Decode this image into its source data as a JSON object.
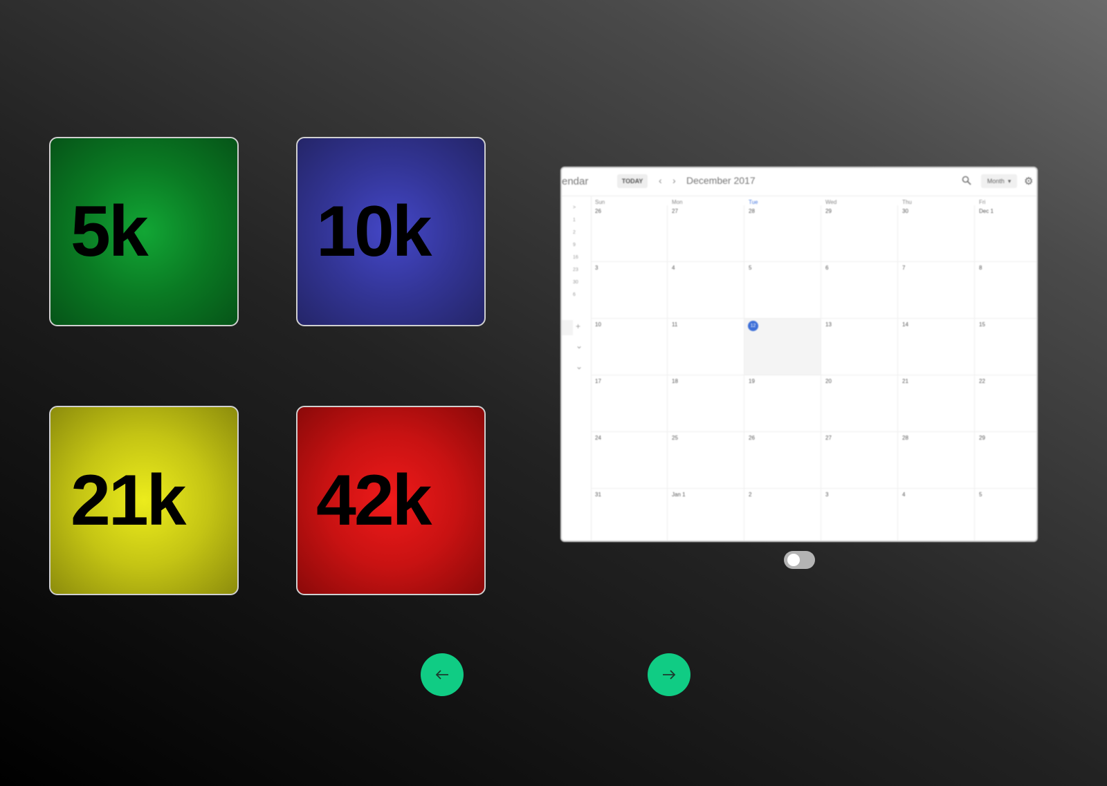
{
  "tiles": [
    {
      "id": "green",
      "label": "5k",
      "color": "#0a7a23"
    },
    {
      "id": "blue",
      "label": "10k",
      "color": "#333596"
    },
    {
      "id": "yellow",
      "label": "21k",
      "color": "#c4c414"
    },
    {
      "id": "red",
      "label": "42k",
      "color": "#c81212"
    }
  ],
  "calendar": {
    "app_name": "endar",
    "today_label": "TODAY",
    "prev_icon": "chevron-left-icon",
    "next_icon": "chevron-right-icon",
    "month_title": "December 2017",
    "view_select": "Month",
    "search_icon": "search-icon",
    "settings_icon": "gear-icon",
    "weekdays": [
      "Sun",
      "Mon",
      "Tue",
      "Wed",
      "Thu",
      "Fri"
    ],
    "highlight_weekday": "Tue",
    "weeks": [
      [
        "26",
        "27",
        "28",
        "29",
        "30",
        "Dec 1"
      ],
      [
        "3",
        "4",
        "5",
        "6",
        "7",
        "8"
      ],
      [
        "10",
        "11",
        "12",
        "13",
        "14",
        "15"
      ],
      [
        "17",
        "18",
        "19",
        "20",
        "21",
        "22"
      ],
      [
        "24",
        "25",
        "26",
        "27",
        "28",
        "29"
      ],
      [
        "31",
        "Jan 1",
        "2",
        "3",
        "4",
        "5"
      ]
    ],
    "today_date": "12",
    "mini_sidebar": [
      ">",
      "1",
      "2",
      "9",
      "16",
      "23",
      "30",
      "6"
    ]
  },
  "toggle": {
    "on": false
  },
  "nav": {
    "prev_icon": "arrow-left-icon",
    "next_icon": "arrow-right-icon",
    "accent": "#10cc84"
  }
}
